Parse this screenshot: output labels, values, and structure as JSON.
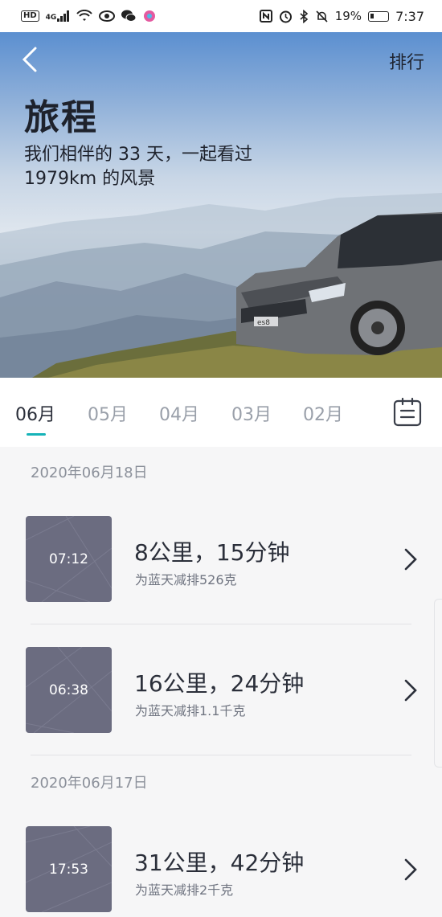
{
  "status_bar": {
    "network_tag": "HD",
    "signal_label": "4G",
    "battery": "19%",
    "time": "7:37"
  },
  "header": {
    "back_icon": "chevron-left-icon",
    "ranking_label": "排行",
    "title": "旅程",
    "subtitle_line1": "我们相伴的 33 天，一起看过",
    "subtitle_line2": "1979km 的风景"
  },
  "tabs": [
    {
      "label": "06月",
      "active": true
    },
    {
      "label": "05月",
      "active": false
    },
    {
      "label": "04月",
      "active": false
    },
    {
      "label": "03月",
      "active": false
    },
    {
      "label": "02月",
      "active": false
    }
  ],
  "calendar_icon": "calendar-icon",
  "groups": [
    {
      "date": "2020年06月18日",
      "trips": [
        {
          "time": "07:12",
          "summary": "8公里，15分钟",
          "emission": "为蓝天减排526克"
        },
        {
          "time": "06:38",
          "summary": "16公里，24分钟",
          "emission": "为蓝天减排1.1千克"
        }
      ]
    },
    {
      "date": "2020年06月17日",
      "trips": [
        {
          "time": "17:53",
          "summary": "31公里，42分钟",
          "emission": "为蓝天减排2千克"
        }
      ]
    }
  ],
  "car_badge": "es8",
  "colors": {
    "accent": "#16b3b8",
    "thumb_bg": "#6b6c80",
    "text_primary": "#2b2f3a",
    "text_secondary": "#6f7480"
  }
}
